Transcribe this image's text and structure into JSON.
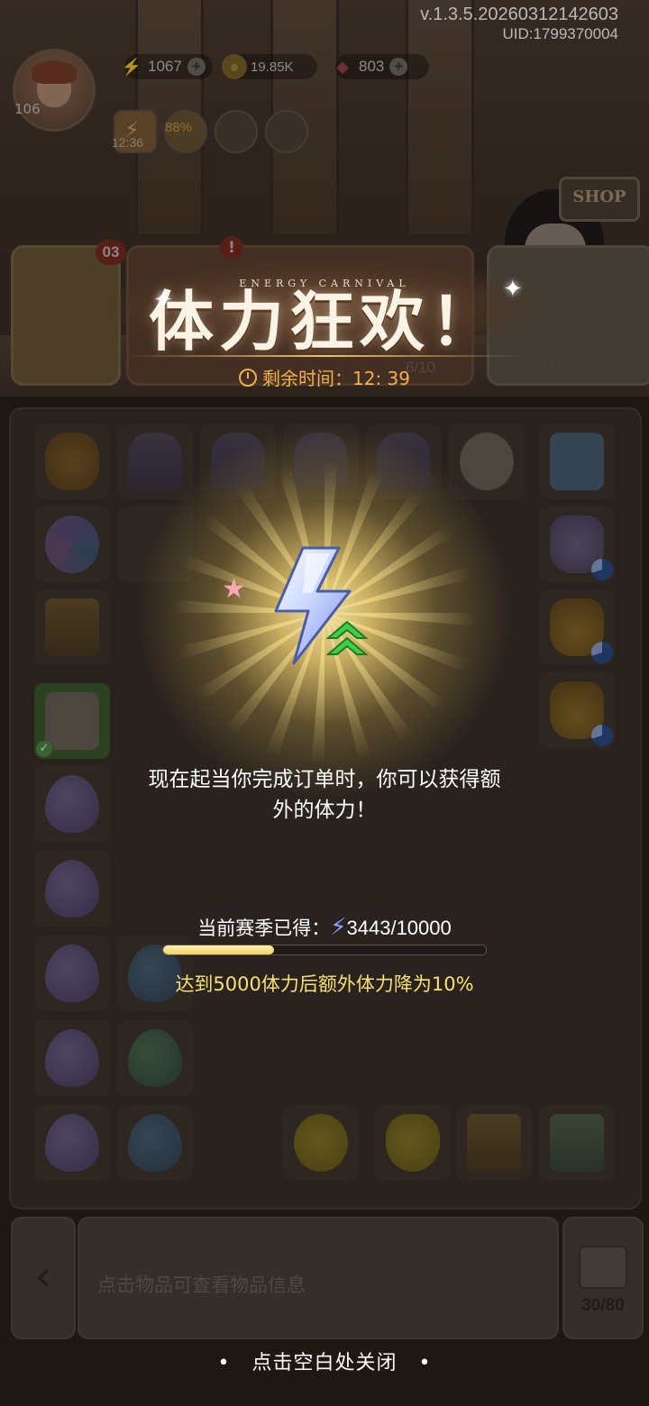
{
  "version": "v.1.3.5.20260312142603",
  "uid": "UID:1799370004",
  "player": {
    "level": "106"
  },
  "resources": {
    "energy": "1067",
    "coins": "19.85K",
    "gems": "803"
  },
  "energy_timer": "12:36",
  "bonus_percent": "88%",
  "shop_label": "SHOP",
  "order_badge": "03",
  "order_alert": "!",
  "counts": {
    "a": "1/1",
    "b": "0/1",
    "c": "6/10"
  },
  "event": {
    "subtitle": "ENERGY CARNIVAL",
    "title": "体力狂欢！",
    "timer_label": "剩余时间：",
    "timer_value": "12: 39"
  },
  "message": {
    "line1": "现在起当你完成订单时，你可以获得额",
    "line2": "外的体力！"
  },
  "season": {
    "label": "当前赛季已得：",
    "current": 3443,
    "goal": 10000,
    "progress_text": "3443/10000"
  },
  "warning": "达到5000体力后额外体力降为10%",
  "info_placeholder": "点击物品可查看物品信息",
  "bag_count": "30/80",
  "close_hint": "点击空白处关闭",
  "colors": {
    "accent_gold": "#f0b04a",
    "warning_yellow": "#f7e172",
    "progress_fill": "#f2cf62"
  },
  "icons": [
    "lightning-icon",
    "coin-icon",
    "gem-icon",
    "plus-icon",
    "clock-icon",
    "back-arrow-icon",
    "box-icon",
    "checkmark-icon",
    "sparkle-icon",
    "star-icon",
    "chevron-up-icon"
  ]
}
